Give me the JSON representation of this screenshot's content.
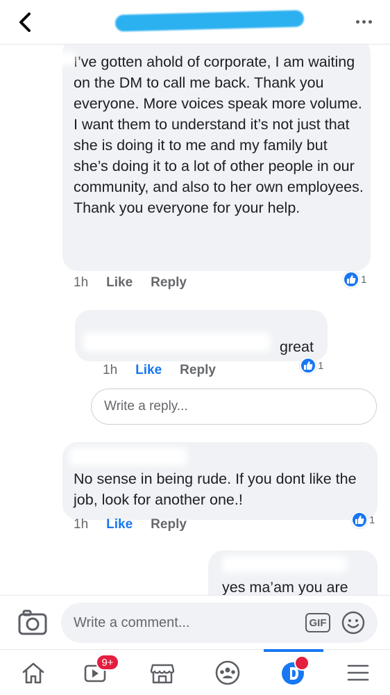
{
  "header": {
    "more_label": "..."
  },
  "comments": [
    {
      "text": "I’ve gotten ahold of corporate, I am waiting on the DM to call me back. Thank you everyone. More voices speak more volume. I want them to understand it’s not just that she is doing it to me and my family but she’s doing it to a lot of other people in our community, and also to her own employees. Thank you everyone for your help.",
      "time": "1h",
      "like_label": "Like",
      "reply_label": "Reply",
      "reaction_count": "1"
    },
    {
      "text": "great",
      "time": "1h",
      "like_label": "Like",
      "reply_label": "Reply",
      "reaction_count": "1"
    },
    {
      "text": "No sense in being rude. If you dont like the job, look for another one.!",
      "time": "1h",
      "like_label": "Like",
      "reply_label": "Reply",
      "reaction_count": "1"
    },
    {
      "text": "yes ma’am you are"
    }
  ],
  "reply_box": {
    "placeholder": "Write a reply..."
  },
  "composer": {
    "placeholder": "Write a comment...",
    "gif_label": "GIF"
  },
  "bottom_nav": {
    "items": [
      "home-icon",
      "watch-icon",
      "marketplace-icon",
      "groups-icon",
      "dating-icon",
      "menu-icon"
    ],
    "watch_badge": "9+",
    "active_index": 4
  },
  "colors": {
    "accent": "#1877f2",
    "bubble": "#f0f2f5",
    "badge": "#e41e3f",
    "title_scribble": "#2bb0f0"
  }
}
